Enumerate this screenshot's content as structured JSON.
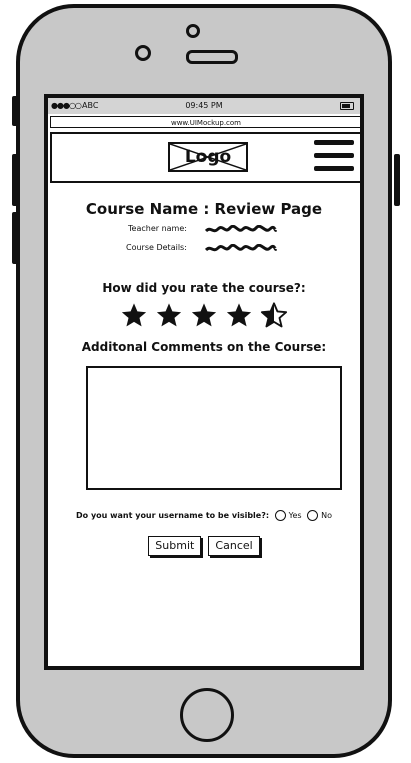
{
  "statusbar": {
    "signal": "●●●○○",
    "carrier": "ABC",
    "time": "09:45 PM",
    "battery_icon": "battery-icon"
  },
  "browser": {
    "url": "www.UIMockup.com"
  },
  "navbar": {
    "logo_text": "Logo",
    "menu_icon": "hamburger-menu-icon"
  },
  "page": {
    "title": "Course Name : Review Page",
    "teacher_label": "Teacher name:",
    "course_details_label": "Course Details:",
    "rating_question": "How did you rate the course?:",
    "rating": {
      "value": 4.5,
      "max": 5
    },
    "comments_label": "Additonal Comments on the Course:",
    "comments_value": "",
    "visibility_question": "Do you want your username to be visible?:",
    "visibility_options": [
      "Yes",
      "No"
    ],
    "submit_label": "Submit",
    "cancel_label": "Cancel"
  }
}
